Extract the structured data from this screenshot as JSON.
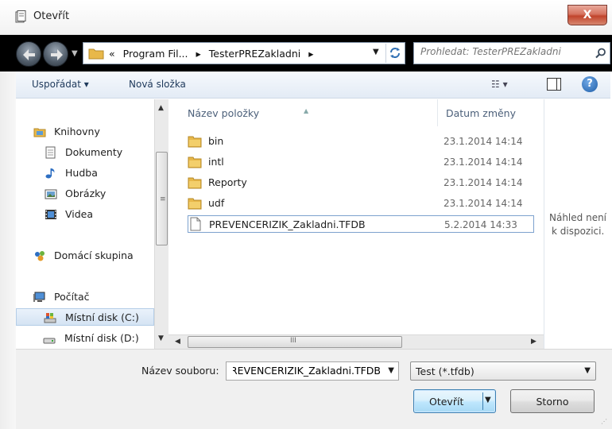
{
  "window": {
    "title": "Otevřít",
    "close_label": "X"
  },
  "address": {
    "crumbs": [
      "«",
      "Program Fil...",
      "▸",
      "TesterPREZakladni",
      "▸"
    ],
    "search_placeholder": "Prohledat: TesterPREZakladni"
  },
  "toolbar": {
    "organize_label": "Uspořádat ▾",
    "new_folder_label": "Nová složka",
    "views_label": "☷ ▾",
    "help_label": "?"
  },
  "navigation": {
    "items": [
      {
        "label": "Knihovny",
        "icon": "libraries-icon"
      },
      {
        "label": "Dokumenty",
        "icon": "documents-icon"
      },
      {
        "label": "Hudba",
        "icon": "music-icon"
      },
      {
        "label": "Obrázky",
        "icon": "pictures-icon"
      },
      {
        "label": "Videa",
        "icon": "videos-icon"
      },
      {
        "label": "Domácí skupina",
        "icon": "homegroup-icon"
      },
      {
        "label": "Počítač",
        "icon": "computer-icon"
      },
      {
        "label": "Místní disk (C:)",
        "icon": "system-drive-icon"
      },
      {
        "label": "Místní disk (D:)",
        "icon": "drive-icon"
      }
    ]
  },
  "filelist": {
    "columns": [
      "Název položky",
      "Datum změny"
    ],
    "rows": [
      {
        "name": "bin",
        "date": "23.1.2014 14:14",
        "type": "folder"
      },
      {
        "name": "intl",
        "date": "23.1.2014 14:14",
        "type": "folder"
      },
      {
        "name": "Reporty",
        "date": "23.1.2014 14:14",
        "type": "folder"
      },
      {
        "name": "udf",
        "date": "23.1.2014 14:14",
        "type": "folder"
      },
      {
        "name": "PREVENCERIZIK_Zakladni.TFDB",
        "date": "5.2.2014 14:33",
        "type": "file"
      }
    ],
    "scroll_grip": "III",
    "vscroll_grip": "≡"
  },
  "preview": {
    "text_line1": "Náhled není",
    "text_line2": "k dispozici."
  },
  "bottom": {
    "filename_label": "Název souboru:",
    "filename_value": "PREVENCERIZIK_Zakladni.TFDB",
    "filter_value": "Test (*.tfdb)",
    "open_label": "Otevřít",
    "cancel_label": "Storno"
  },
  "colors": {
    "accent": "#3c7fb1",
    "folder": "#e8b84a",
    "close": "#c1442c"
  }
}
